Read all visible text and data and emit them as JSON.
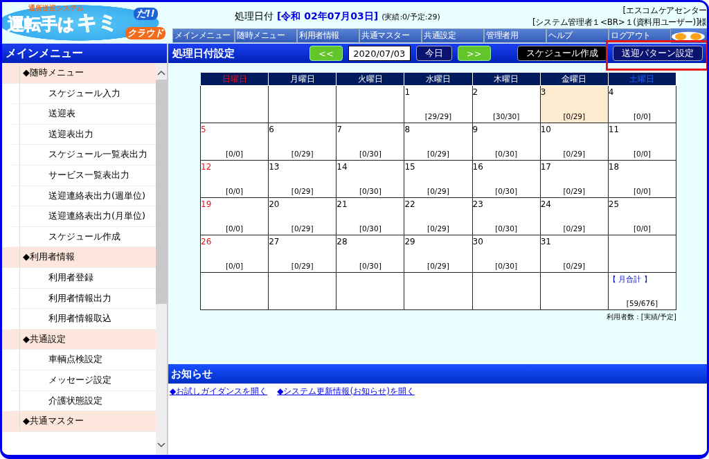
{
  "logo": {
    "tagline": "通所送迎システム",
    "main": "運転手は",
    "accent": "キミ",
    "exclaim": "だ!!",
    "badge": "クラウド"
  },
  "header": {
    "label": "処理日付",
    "date": "[令和 02年07月03日]",
    "summary": "(実績:0/予定:29)",
    "office": "[エスコムケアセンター",
    "user": "[システム管理者１<BR>１(資料用ユーザー)]様"
  },
  "nav": [
    "メインメニュー",
    "随時メニュー",
    "利用者情報",
    "共通マスター",
    "共通設定",
    "管理者用",
    "ヘルプ",
    "ログアウト"
  ],
  "sidebar": {
    "title": "メインメニュー",
    "items": [
      {
        "kind": "section",
        "label": "◆随時メニュー"
      },
      {
        "kind": "item",
        "label": "スケジュール入力"
      },
      {
        "kind": "item",
        "label": "送迎表"
      },
      {
        "kind": "item",
        "label": "送迎表出力"
      },
      {
        "kind": "item",
        "label": "スケジュール一覧表出力"
      },
      {
        "kind": "item",
        "label": "サービス一覧表出力"
      },
      {
        "kind": "item",
        "label": "送迎連絡表出力(週単位)"
      },
      {
        "kind": "item",
        "label": "送迎連絡表出力(月単位)"
      },
      {
        "kind": "item",
        "label": "スケジュール作成"
      },
      {
        "kind": "section",
        "label": "◆利用者情報"
      },
      {
        "kind": "item",
        "label": "利用者登録"
      },
      {
        "kind": "item",
        "label": "利用者情報出力"
      },
      {
        "kind": "item",
        "label": "利用者情報取込"
      },
      {
        "kind": "section",
        "label": "◆共通設定"
      },
      {
        "kind": "item",
        "label": "車輌点検設定"
      },
      {
        "kind": "item",
        "label": "メッセージ設定"
      },
      {
        "kind": "item",
        "label": "介護状態設定"
      },
      {
        "kind": "section",
        "label": "◆共通マスター"
      }
    ]
  },
  "toolbar": {
    "title": "処理日付設定",
    "prev": "<<",
    "date": "2020/07/03",
    "today": "今日",
    "next": ">>",
    "buttons": [
      {
        "label": "スケジュール作成",
        "kind": "dark",
        "highlighted": false
      },
      {
        "label": "送迎パターン設定",
        "kind": "navy",
        "highlighted": true
      }
    ]
  },
  "calendar": {
    "weekdays": [
      "日曜日",
      "月曜日",
      "火曜日",
      "水曜日",
      "木曜日",
      "金曜日",
      "土曜日"
    ],
    "weeks": [
      [
        {
          "kind": "empty"
        },
        {
          "kind": "empty"
        },
        {
          "kind": "empty"
        },
        {
          "kind": "day",
          "day": "1",
          "count": "[29/29]",
          "selected": false
        },
        {
          "kind": "day",
          "day": "2",
          "count": "[30/30]",
          "selected": false
        },
        {
          "kind": "day",
          "day": "3",
          "count": "[0/29]",
          "selected": true
        },
        {
          "kind": "day",
          "day": "4",
          "count": "[0/0]",
          "selected": false
        }
      ],
      [
        {
          "kind": "day",
          "day": "5",
          "count": "[0/0]",
          "selected": false
        },
        {
          "kind": "day",
          "day": "6",
          "count": "[0/29]",
          "selected": false
        },
        {
          "kind": "day",
          "day": "7",
          "count": "[0/30]",
          "selected": false
        },
        {
          "kind": "day",
          "day": "8",
          "count": "[0/29]",
          "selected": false
        },
        {
          "kind": "day",
          "day": "9",
          "count": "[0/30]",
          "selected": false
        },
        {
          "kind": "day",
          "day": "10",
          "count": "[0/29]",
          "selected": false
        },
        {
          "kind": "day",
          "day": "11",
          "count": "[0/0]",
          "selected": false
        }
      ],
      [
        {
          "kind": "day",
          "day": "12",
          "count": "[0/0]",
          "selected": false
        },
        {
          "kind": "day",
          "day": "13",
          "count": "[0/29]",
          "selected": false
        },
        {
          "kind": "day",
          "day": "14",
          "count": "[0/30]",
          "selected": false
        },
        {
          "kind": "day",
          "day": "15",
          "count": "[0/29]",
          "selected": false
        },
        {
          "kind": "day",
          "day": "16",
          "count": "[0/30]",
          "selected": false
        },
        {
          "kind": "day",
          "day": "17",
          "count": "[0/29]",
          "selected": false
        },
        {
          "kind": "day",
          "day": "18",
          "count": "[0/0]",
          "selected": false
        }
      ],
      [
        {
          "kind": "day",
          "day": "19",
          "count": "[0/0]",
          "selected": false
        },
        {
          "kind": "day",
          "day": "20",
          "count": "[0/29]",
          "selected": false
        },
        {
          "kind": "day",
          "day": "21",
          "count": "[0/30]",
          "selected": false
        },
        {
          "kind": "day",
          "day": "22",
          "count": "[0/29]",
          "selected": false
        },
        {
          "kind": "day",
          "day": "23",
          "count": "[0/30]",
          "selected": false
        },
        {
          "kind": "day",
          "day": "24",
          "count": "[0/29]",
          "selected": false
        },
        {
          "kind": "day",
          "day": "25",
          "count": "[0/0]",
          "selected": false
        }
      ],
      [
        {
          "kind": "day",
          "day": "26",
          "count": "[0/0]",
          "selected": false
        },
        {
          "kind": "day",
          "day": "27",
          "count": "[0/29]",
          "selected": false
        },
        {
          "kind": "day",
          "day": "28",
          "count": "[0/30]",
          "selected": false
        },
        {
          "kind": "day",
          "day": "29",
          "count": "[0/29]",
          "selected": false
        },
        {
          "kind": "day",
          "day": "30",
          "count": "[0/30]",
          "selected": false
        },
        {
          "kind": "day",
          "day": "31",
          "count": "[0/29]",
          "selected": false
        },
        {
          "kind": "empty"
        }
      ],
      [
        {
          "kind": "empty"
        },
        {
          "kind": "empty"
        },
        {
          "kind": "empty"
        },
        {
          "kind": "empty"
        },
        {
          "kind": "empty"
        },
        {
          "kind": "empty"
        },
        {
          "kind": "total",
          "label": "【 月合計 】",
          "count": "[59/676]"
        }
      ]
    ],
    "legend": "利用者数：[実績/予定]"
  },
  "notice": {
    "title": "お知らせ",
    "links": [
      "◆お試しガイダンスを開く",
      "◆システム更新情報(お知らせ)を開く"
    ]
  }
}
